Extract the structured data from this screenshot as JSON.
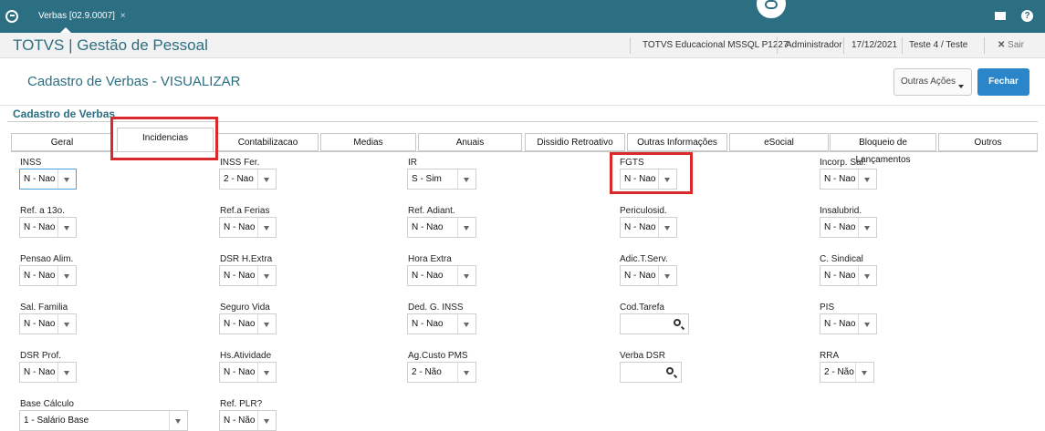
{
  "topbar": {
    "tab_title": "Verbas [02.9.0007]",
    "tab_close": "×"
  },
  "appbar": {
    "app_title": "TOTVS | Gestão de Pessoal",
    "environment": "TOTVS Educacional MSSQL P1227",
    "user": "Administrador",
    "date": "17/12/2021",
    "company": "Teste 4 / Teste",
    "exit_label": "Sair",
    "exit_icon": "✕"
  },
  "header": {
    "page_title": "Cadastro de Verbas - VISUALIZAR",
    "other_actions_label": "Outras Ações",
    "close_label": "Fechar"
  },
  "section_title": "Cadastro de Verbas",
  "tabs": [
    "Geral",
    "Incidencias",
    "Contabilizacao",
    "Medias",
    "Anuais",
    "Dissidio Retroativo",
    "Outras Informações",
    "eSocial",
    "Bloqueio de Lançamentos",
    "Outros"
  ],
  "active_tab": "Incidencias",
  "fields": {
    "inss": {
      "label": "INSS",
      "value": "N - Nao"
    },
    "inss_fer": {
      "label": "INSS Fer.",
      "value": "2 - Nao"
    },
    "ir": {
      "label": "IR",
      "value": "S - Sim"
    },
    "fgts": {
      "label": "FGTS",
      "value": "N - Nao"
    },
    "incorp_sal": {
      "label": "Incorp. Sal.",
      "value": "N - Nao"
    },
    "ref_13o": {
      "label": "Ref. a 13o.",
      "value": "N - Nao"
    },
    "ref_ferias": {
      "label": "Ref.a Ferias",
      "value": "N - Nao"
    },
    "ref_adiant": {
      "label": "Ref. Adiant.",
      "value": "N - Nao"
    },
    "periculosid": {
      "label": "Periculosid.",
      "value": "N - Nao"
    },
    "insalubrid": {
      "label": "Insalubrid.",
      "value": "N - Nao"
    },
    "pensao_alim": {
      "label": "Pensao Alim.",
      "value": "N - Nao"
    },
    "dsr_hextra": {
      "label": "DSR H.Extra",
      "value": "N - Nao"
    },
    "hora_extra": {
      "label": "Hora Extra",
      "value": "N - Nao"
    },
    "adic_tserv": {
      "label": "Adic.T.Serv.",
      "value": "N - Nao"
    },
    "c_sindical": {
      "label": "C. Sindical",
      "value": "N - Nao"
    },
    "sal_familia": {
      "label": "Sal. Familia",
      "value": "N - Nao"
    },
    "seguro_vida": {
      "label": "Seguro Vida",
      "value": "N - Nao"
    },
    "ded_g_inss": {
      "label": "Ded. G. INSS",
      "value": "N - Nao"
    },
    "cod_tarefa": {
      "label": "Cod.Tarefa",
      "value": ""
    },
    "pis": {
      "label": "PIS",
      "value": "N - Nao"
    },
    "dsr_prof": {
      "label": "DSR Prof.",
      "value": "N - Nao"
    },
    "hs_atividade": {
      "label": "Hs.Atividade",
      "value": "N - Nao"
    },
    "ag_custo_pms": {
      "label": "Ag.Custo PMS",
      "value": "2 - Não"
    },
    "verba_dsr": {
      "label": "Verba DSR",
      "value": ""
    },
    "rra": {
      "label": "RRA",
      "value": "2 - Não"
    },
    "base_calculo": {
      "label": "Base Cálculo",
      "value": "1 - Salário Base"
    },
    "ref_plr": {
      "label": "Ref. PLR?",
      "value": "N - Não"
    }
  },
  "colors": {
    "brand": "#2c6f82",
    "primary_button": "#2a86c9",
    "highlight": "#d9292b"
  }
}
